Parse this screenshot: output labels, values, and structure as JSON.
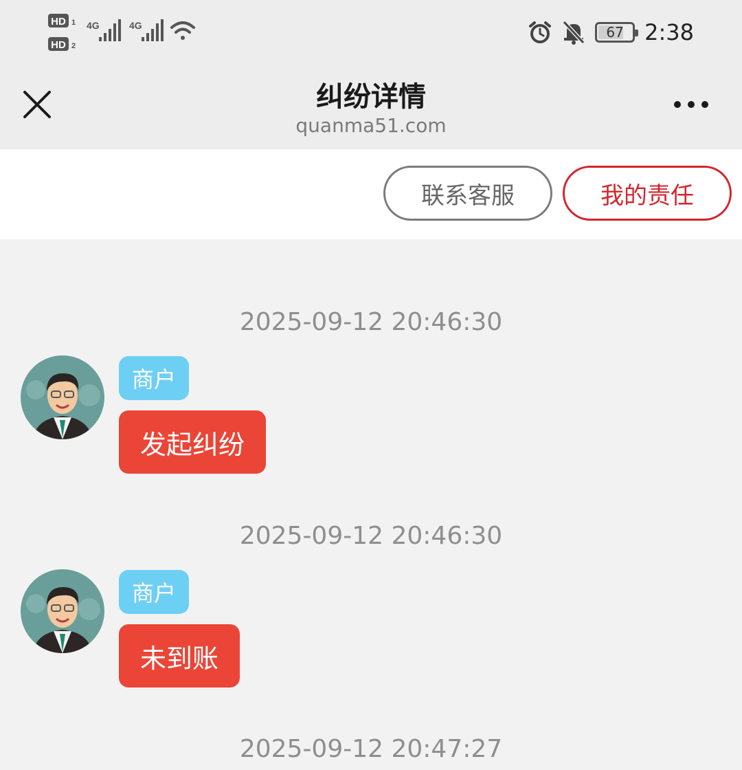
{
  "status_bar": {
    "time": "2:38",
    "battery": "67",
    "sim1_label": "HD",
    "sim2_label": "HD",
    "network1": "4G",
    "network2": "4G"
  },
  "nav": {
    "title": "纠纷详情",
    "subtitle": "quanma51.com"
  },
  "actions": {
    "contact_service": "联系客服",
    "my_responsibility": "我的责任"
  },
  "messages": [
    {
      "timestamp": "2025-09-12 20:46:30",
      "role": "商户",
      "text": "发起纠纷"
    },
    {
      "timestamp": "2025-09-12 20:46:30",
      "role": "商户",
      "text": "未到账"
    },
    {
      "timestamp": "2025-09-12 20:47:27"
    }
  ],
  "colors": {
    "accent_red": "#d3262e",
    "bubble_red": "#ea4536",
    "role_tag_blue": "#6ecff5"
  },
  "icons": [
    "close-icon",
    "more-icon",
    "alarm-icon",
    "mute-icon",
    "battery-icon",
    "wifi-icon",
    "signal-icon"
  ]
}
